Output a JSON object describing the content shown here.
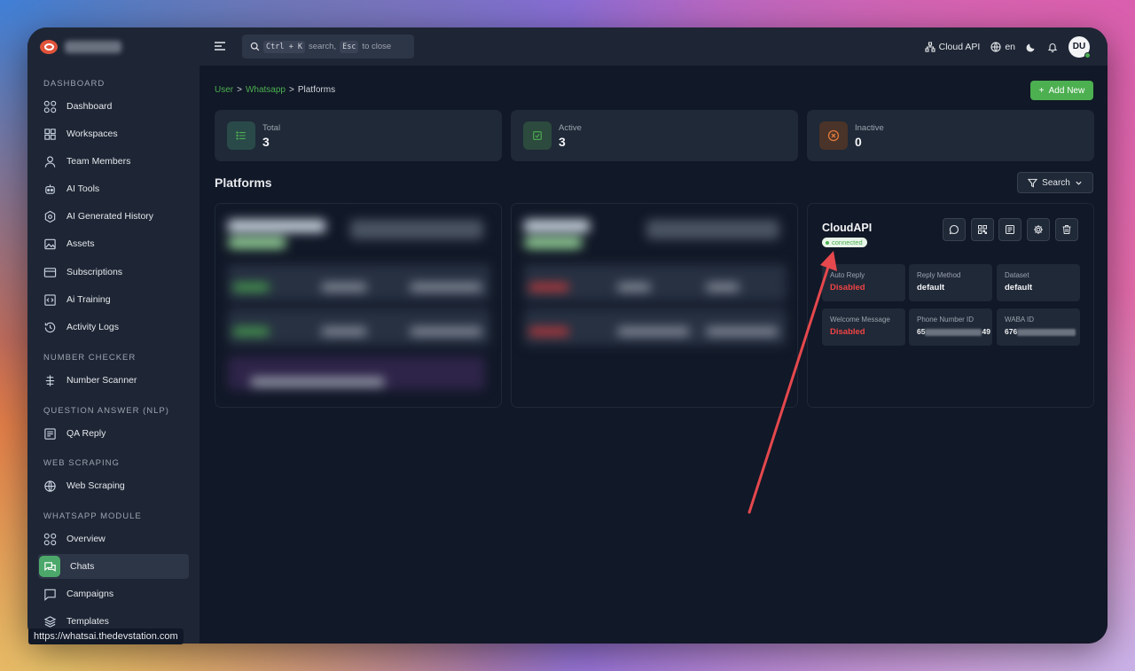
{
  "sidebar": {
    "sections": [
      {
        "title": "DASHBOARD",
        "items": [
          {
            "label": "Dashboard",
            "icon": "grid-circles-icon"
          },
          {
            "label": "Workspaces",
            "icon": "grid-squares-icon"
          },
          {
            "label": "Team Members",
            "icon": "user-icon"
          },
          {
            "label": "AI Tools",
            "icon": "robot-icon"
          },
          {
            "label": "AI Generated History",
            "icon": "hexagon-icon"
          },
          {
            "label": "Assets",
            "icon": "image-icon"
          },
          {
            "label": "Subscriptions",
            "icon": "credit-card-icon"
          },
          {
            "label": "Ai Training",
            "icon": "code-box-icon"
          },
          {
            "label": "Activity Logs",
            "icon": "history-icon"
          }
        ]
      },
      {
        "title": "NUMBER CHECKER",
        "items": [
          {
            "label": "Number Scanner",
            "icon": "scanner-icon"
          }
        ]
      },
      {
        "title": "QUESTION ANSWER (NLP)",
        "items": [
          {
            "label": "QA Reply",
            "icon": "message-box-icon"
          }
        ]
      },
      {
        "title": "WEB SCRAPING",
        "items": [
          {
            "label": "Web Scraping",
            "icon": "globe-icon"
          }
        ]
      },
      {
        "title": "WHATSAPP MODULE",
        "items": [
          {
            "label": "Overview",
            "icon": "grid-circles-icon"
          },
          {
            "label": "Chats",
            "icon": "chat-icon",
            "active": true
          },
          {
            "label": "Campaigns",
            "icon": "message-square-icon"
          },
          {
            "label": "Templates",
            "icon": "layers-icon"
          }
        ]
      }
    ]
  },
  "topbar": {
    "search_kbd1": "Ctrl + K",
    "search_mid": "search,",
    "search_kbd2": "Esc",
    "search_end": "to close",
    "cloud_api": "Cloud API",
    "lang": "en",
    "avatar": "DU"
  },
  "breadcrumb": {
    "user": "User",
    "whatsapp": "Whatsapp",
    "current": "Platforms",
    "sep": ">"
  },
  "add_new": "Add New",
  "stats": [
    {
      "label": "Total",
      "value": "3",
      "icon": "list-icon",
      "color": "#4caf50",
      "bg": "#2a4a4a"
    },
    {
      "label": "Active",
      "value": "3",
      "icon": "check-square-icon",
      "color": "#4caf50",
      "bg": "#2c4a3e"
    },
    {
      "label": "Inactive",
      "value": "0",
      "icon": "x-circle-icon",
      "color": "#e07a3c",
      "bg": "#4a3328"
    }
  ],
  "platforms_title": "Platforms",
  "search_label": "Search",
  "cloud_card": {
    "title": "CloudAPI",
    "status": "connected",
    "auto_reply_label": "Auto Reply",
    "auto_reply_value": "Disabled",
    "reply_method_label": "Reply Method",
    "reply_method_value": "default",
    "dataset_label": "Dataset",
    "dataset_value": "default",
    "welcome_label": "Welcome Message",
    "welcome_value": "Disabled",
    "phone_label": "Phone Number ID",
    "phone_prefix": "65",
    "phone_suffix": "49",
    "waba_label": "WABA ID",
    "waba_prefix": "676"
  },
  "status_url": "https://whatsai.thedevstation.com",
  "colors": {
    "accent": "#4caf50",
    "danger": "#ef4444",
    "arrow": "#e5484d"
  }
}
